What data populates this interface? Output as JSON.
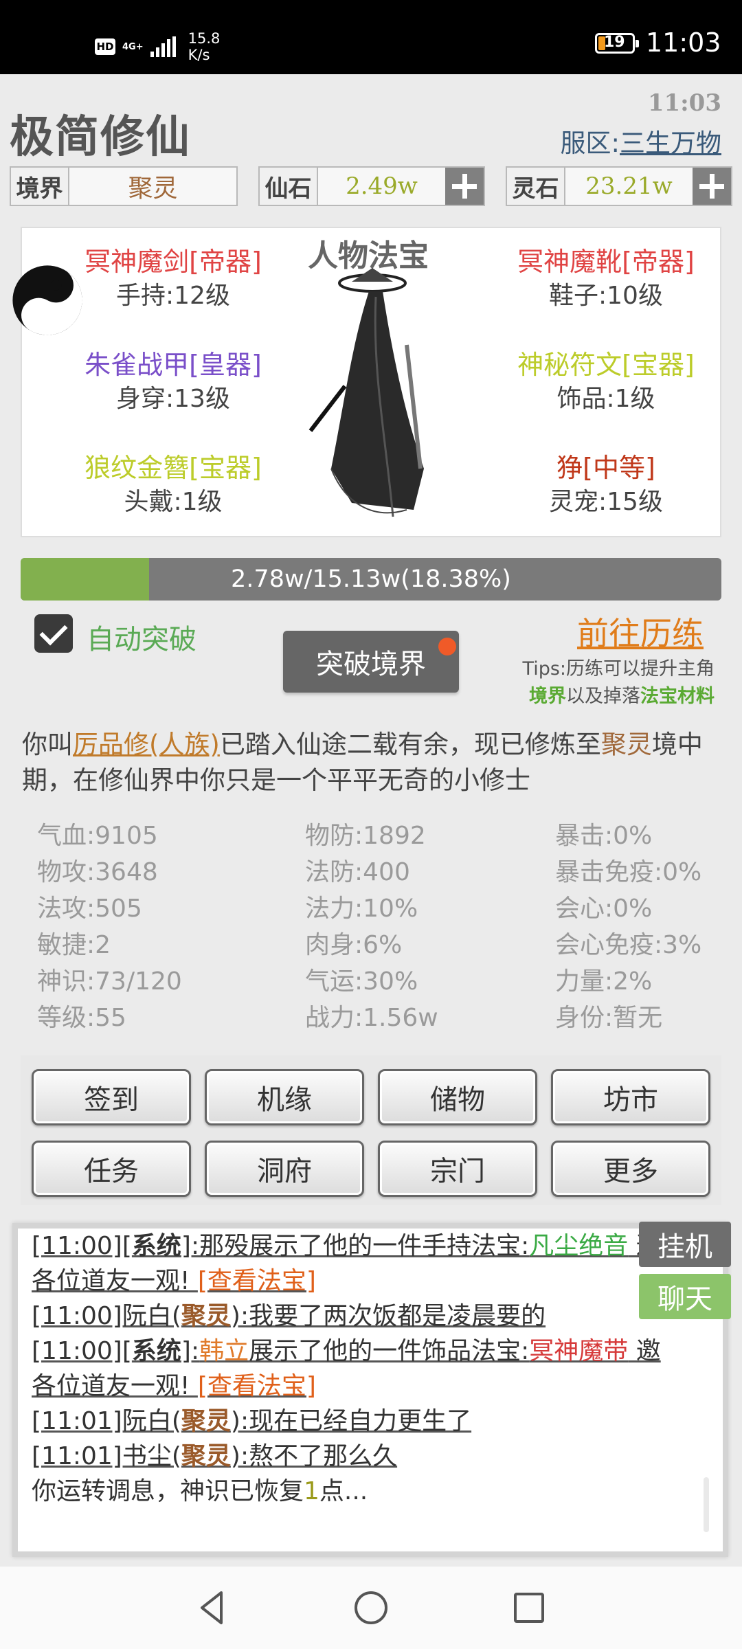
{
  "status_bar": {
    "hd": "HD",
    "network": "4G+",
    "speed_value": "15.8",
    "speed_unit": "K/s",
    "battery": "19",
    "time": "11:03"
  },
  "app": {
    "title": "极简修仙",
    "clock": "11:03",
    "server_label": "服区:",
    "server_name": "三生万物"
  },
  "resources": {
    "realm_label": "境界",
    "realm_value": "聚灵",
    "stone_label": "仙石",
    "stone_value": "2.49w",
    "spirit_label": "灵石",
    "spirit_value": "23.21w"
  },
  "equipment": {
    "title": "人物法宝",
    "items": [
      {
        "name": "冥神魔剑[帝器]",
        "slot": "手持:12级",
        "color": "#e04444"
      },
      {
        "name": "冥神魔靴[帝器]",
        "slot": "鞋子:10级",
        "color": "#e04444"
      },
      {
        "name": "朱雀战甲[皇器]",
        "slot": "身穿:13级",
        "color": "#7a4fc9"
      },
      {
        "name": "神秘符文[宝器]",
        "slot": "饰品:1级",
        "color": "#bccc2a"
      },
      {
        "name": "狼纹金簪[宝器]",
        "slot": "头戴:1级",
        "color": "#bccc2a"
      },
      {
        "name": "狰[中等]",
        "slot": "灵宠:15级",
        "color": "#c0381a"
      }
    ]
  },
  "progress": {
    "text": "2.78w/15.13w(18.38%)",
    "fraction": 0.1838
  },
  "controls": {
    "auto_label": "自动突破",
    "auto_checked": true,
    "breakthrough_label": "突破境界",
    "train_label": "前往历练",
    "tips_line1": "Tips:历练可以提升主角",
    "tips_hl1": "境界",
    "tips_mid": "以及掉落",
    "tips_hl2": "法宝材料"
  },
  "intro": {
    "p1": "你叫",
    "name": "厉品修(人族)",
    "p2": "已踏入仙途二载有余，现已修炼至",
    "realm": "聚灵",
    "p3": "境中期，在修仙界中你只是一个平平无奇的小修士"
  },
  "stats": [
    [
      "气血:9105",
      "物防:1892",
      "暴击:0%"
    ],
    [
      "物攻:3648",
      "法防:400",
      "暴击免疫:0%"
    ],
    [
      "法攻:505",
      "法力:10%",
      "会心:0%"
    ],
    [
      "敏捷:2",
      "肉身:6%",
      "会心免疫:3%"
    ],
    [
      "神识:73/120",
      "气运:30%",
      "力量:2%"
    ],
    [
      "等级:55",
      "战力:1.56w",
      "身份:暂无"
    ]
  ],
  "menu": [
    "签到",
    "机缘",
    "储物",
    "坊市",
    "任务",
    "洞府",
    "宗门",
    "更多"
  ],
  "chat": {
    "hang_label": "挂机",
    "chat_label": "聊天",
    "l1a": "[11:00][",
    "l1sys": "系统",
    "l1b": "]:那殁展示了他的一件手持法宝:",
    "l1item": "凡尘绝音",
    "l1c": " 邀",
    "l2a": "各位道友一观! ",
    "l2link": "[查看法宝]",
    "l3a": "[11:00]阮白(",
    "l3jl": "聚灵",
    "l3b": "):我要了两次饭都是凌晨要的",
    "l4a": "[11:00][",
    "l4sys": "系统",
    "l4b": "]:",
    "l4who": "韩立",
    "l4c": "展示了他的一件饰品法宝:",
    "l4item": "冥神魔带",
    "l4d": " 邀",
    "l5a": "各位道友一观! ",
    "l5link": "[查看法宝]",
    "l6a": "[11:01]阮白(",
    "l6jl": "聚灵",
    "l6b": "):现在已经自力更生了",
    "l7a": "[11:01]书尘(",
    "l7jl": "聚灵",
    "l7b": "):熬不了那么久",
    "l8a": "你运转调息，神识已恢复",
    "l8num": "1",
    "l8b": "点..."
  }
}
